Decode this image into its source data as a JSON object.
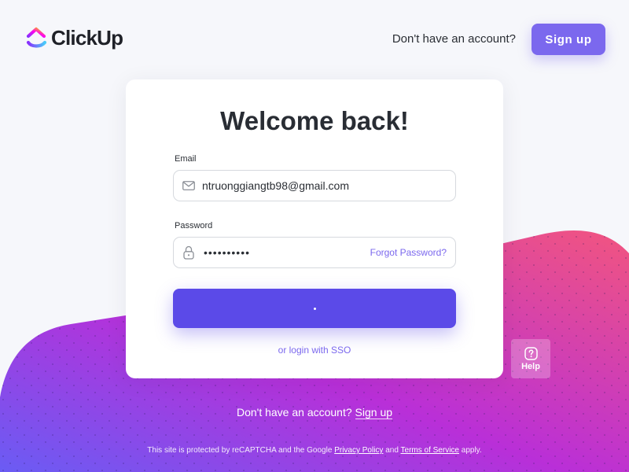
{
  "brand": {
    "name": "ClickUp",
    "colors": {
      "accent": "#7b68ee",
      "button": "#5b4ae8",
      "logo_purple": "#8930fd",
      "logo_pink": "#ff02f0",
      "logo_orange": "#ffc800",
      "logo_blue": "#49ccf9",
      "bg_gradient_start": "#7b68ee",
      "bg_gradient_mid": "#c12fd9",
      "bg_gradient_end": "#f05a8c"
    }
  },
  "header": {
    "prompt": "Don't have an account?",
    "signup_label": "Sign up"
  },
  "login": {
    "title": "Welcome back!",
    "email_label": "Email",
    "email_value": "ntruonggiangtb98@gmail.com",
    "email_icon": "mail-icon",
    "password_label": "Password",
    "password_value": "••••••••••",
    "password_icon": "lock-icon",
    "forgot_label": "Forgot Password?",
    "sso_label": "or login with SSO"
  },
  "help": {
    "label": "Help",
    "icon": "question-icon"
  },
  "footer": {
    "prompt": "Don't have an account?",
    "signup_label": "Sign up",
    "recaptcha_prefix": "This site is protected by reCAPTCHA and the Google",
    "privacy_label": "Privacy Policy",
    "and_label": "and",
    "terms_label": "Terms of Service",
    "recaptcha_suffix": "apply."
  }
}
